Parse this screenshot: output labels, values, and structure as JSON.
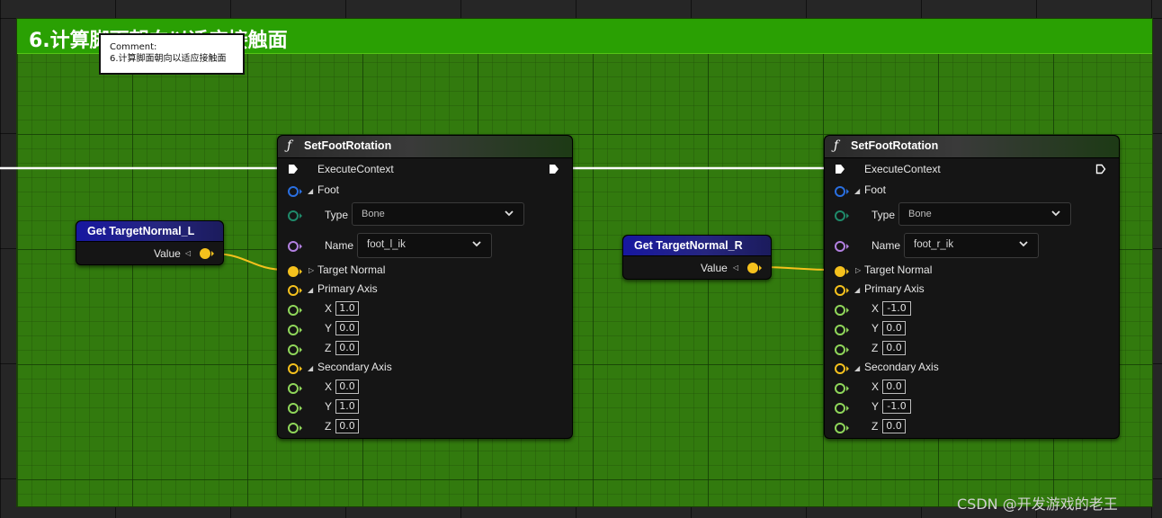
{
  "comment": {
    "title": "6.计算脚面朝向以适应接触面",
    "tooltip_label": "Comment:",
    "tooltip_text": "6.计算脚面朝向以适应接触面"
  },
  "getters": [
    {
      "title": "Get TargetNormal_L",
      "value_label": "Value"
    },
    {
      "title": "Get TargetNormal_R",
      "value_label": "Value"
    }
  ],
  "nodes": [
    {
      "title": "SetFootRotation",
      "execute_label": "ExecuteContext",
      "foot_label": "Foot",
      "type_label": "Type",
      "type_value": "Bone",
      "name_label": "Name",
      "name_value": "foot_l_ik",
      "target_normal_label": "Target Normal",
      "primary_axis_label": "Primary Axis",
      "primary": {
        "x_label": "X",
        "x": "1.0",
        "y_label": "Y",
        "y": "0.0",
        "z_label": "Z",
        "z": "0.0"
      },
      "secondary_axis_label": "Secondary Axis",
      "secondary": {
        "x_label": "X",
        "x": "0.0",
        "y_label": "Y",
        "y": "1.0",
        "z_label": "Z",
        "z": "0.0"
      }
    },
    {
      "title": "SetFootRotation",
      "execute_label": "ExecuteContext",
      "foot_label": "Foot",
      "type_label": "Type",
      "type_value": "Bone",
      "name_label": "Name",
      "name_value": "foot_r_ik",
      "target_normal_label": "Target Normal",
      "primary_axis_label": "Primary Axis",
      "primary": {
        "x_label": "X",
        "x": "-1.0",
        "y_label": "Y",
        "y": "0.0",
        "z_label": "Z",
        "z": "0.0"
      },
      "secondary_axis_label": "Secondary Axis",
      "secondary": {
        "x_label": "X",
        "x": "0.0",
        "y_label": "Y",
        "y": "-1.0",
        "z_label": "Z",
        "z": "0.0"
      }
    }
  ],
  "icons": {
    "function": "function-icon",
    "exec": "exec-pin-icon",
    "dropdown": "chevron-down-icon"
  },
  "colors": {
    "comment_header": "#2aa003",
    "comment_body": "#327a0e",
    "getter_header": "#1717a0",
    "pin_vector": "#f5c11d",
    "pin_float": "#8fd65a",
    "pin_struct": "#2a6fe0",
    "pin_name": "#b280e0",
    "wire_exec": "#ffffff",
    "wire_vector": "#f5c11d"
  },
  "watermark": "CSDN @开发游戏的老王"
}
